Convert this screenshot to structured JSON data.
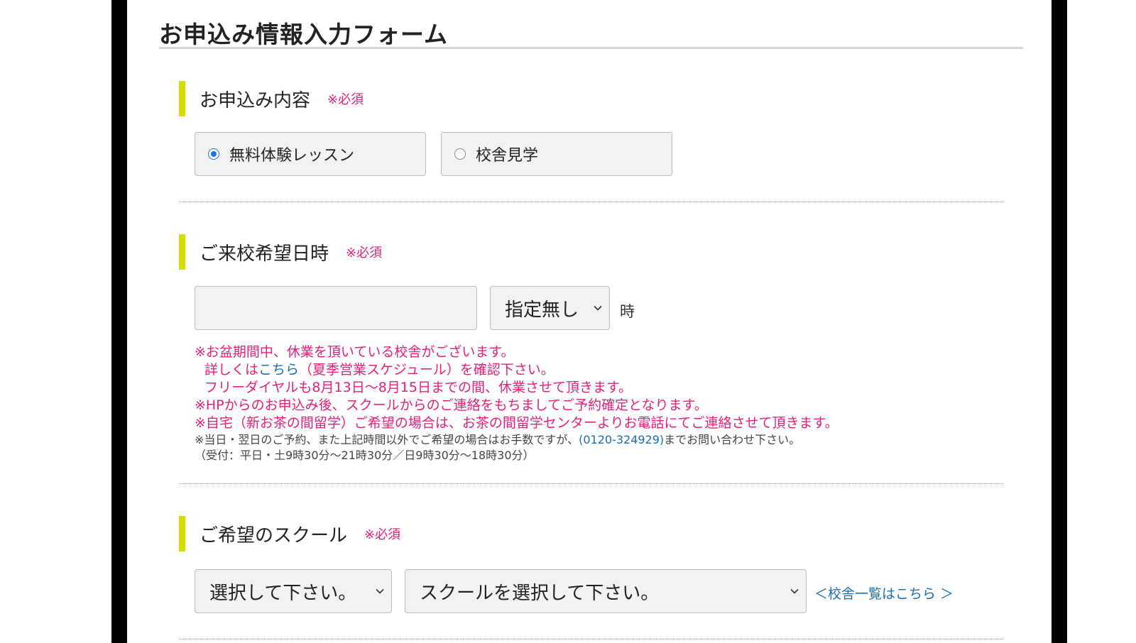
{
  "form": {
    "title": "お申込み情報入力フォーム"
  },
  "section1": {
    "label": "お申込み内容",
    "required": "※必須",
    "options": [
      {
        "label": "無料体験レッスン",
        "checked": true
      },
      {
        "label": "校舎見学",
        "checked": false
      }
    ]
  },
  "section2": {
    "label": "ご来校希望日時",
    "required": "※必須",
    "date_value": "",
    "hour_select": "指定無し",
    "hour_unit": "時",
    "notes": {
      "line1": "※お盆期間中、休業を頂いている校舎がございます。",
      "line2_pre": "詳しくは",
      "line2_link": "こちら",
      "line2_post": "（夏季営業スケジュール）を確認下さい。",
      "line3": "フリーダイヤルも8月13日〜8月15日までの間、休業させて頂きます。",
      "line4": "※HPからのお申込み後、スクールからのご連絡をもちましてご予約確定となります。",
      "line5": "※自宅（新お茶の間留学）ご希望の場合は、お茶の間留学センターよりお電話にてご連絡させて頂きます。",
      "line6_pre": "※当日・翌日のご予約、また上記時間以外でご希望の場合はお手数ですが、",
      "line6_link": "(0120-324929)",
      "line6_post": "までお問い合わせ下さい。",
      "line7": "（受付：平日・土9時30分〜21時30分／日9時30分〜18時30分）"
    }
  },
  "section3": {
    "label": "ご希望のスクール",
    "required": "※必須",
    "area_select": "選択して下さい。",
    "school_select": "スクールを選択して下さい。",
    "school_list_link": "＜校舎一覧はこちら ＞"
  },
  "colors": {
    "accent_bar": "#d5dc00",
    "required_text": "#e6207a",
    "link": "#1a6fb0",
    "radio_selected": "#1a73e8"
  }
}
